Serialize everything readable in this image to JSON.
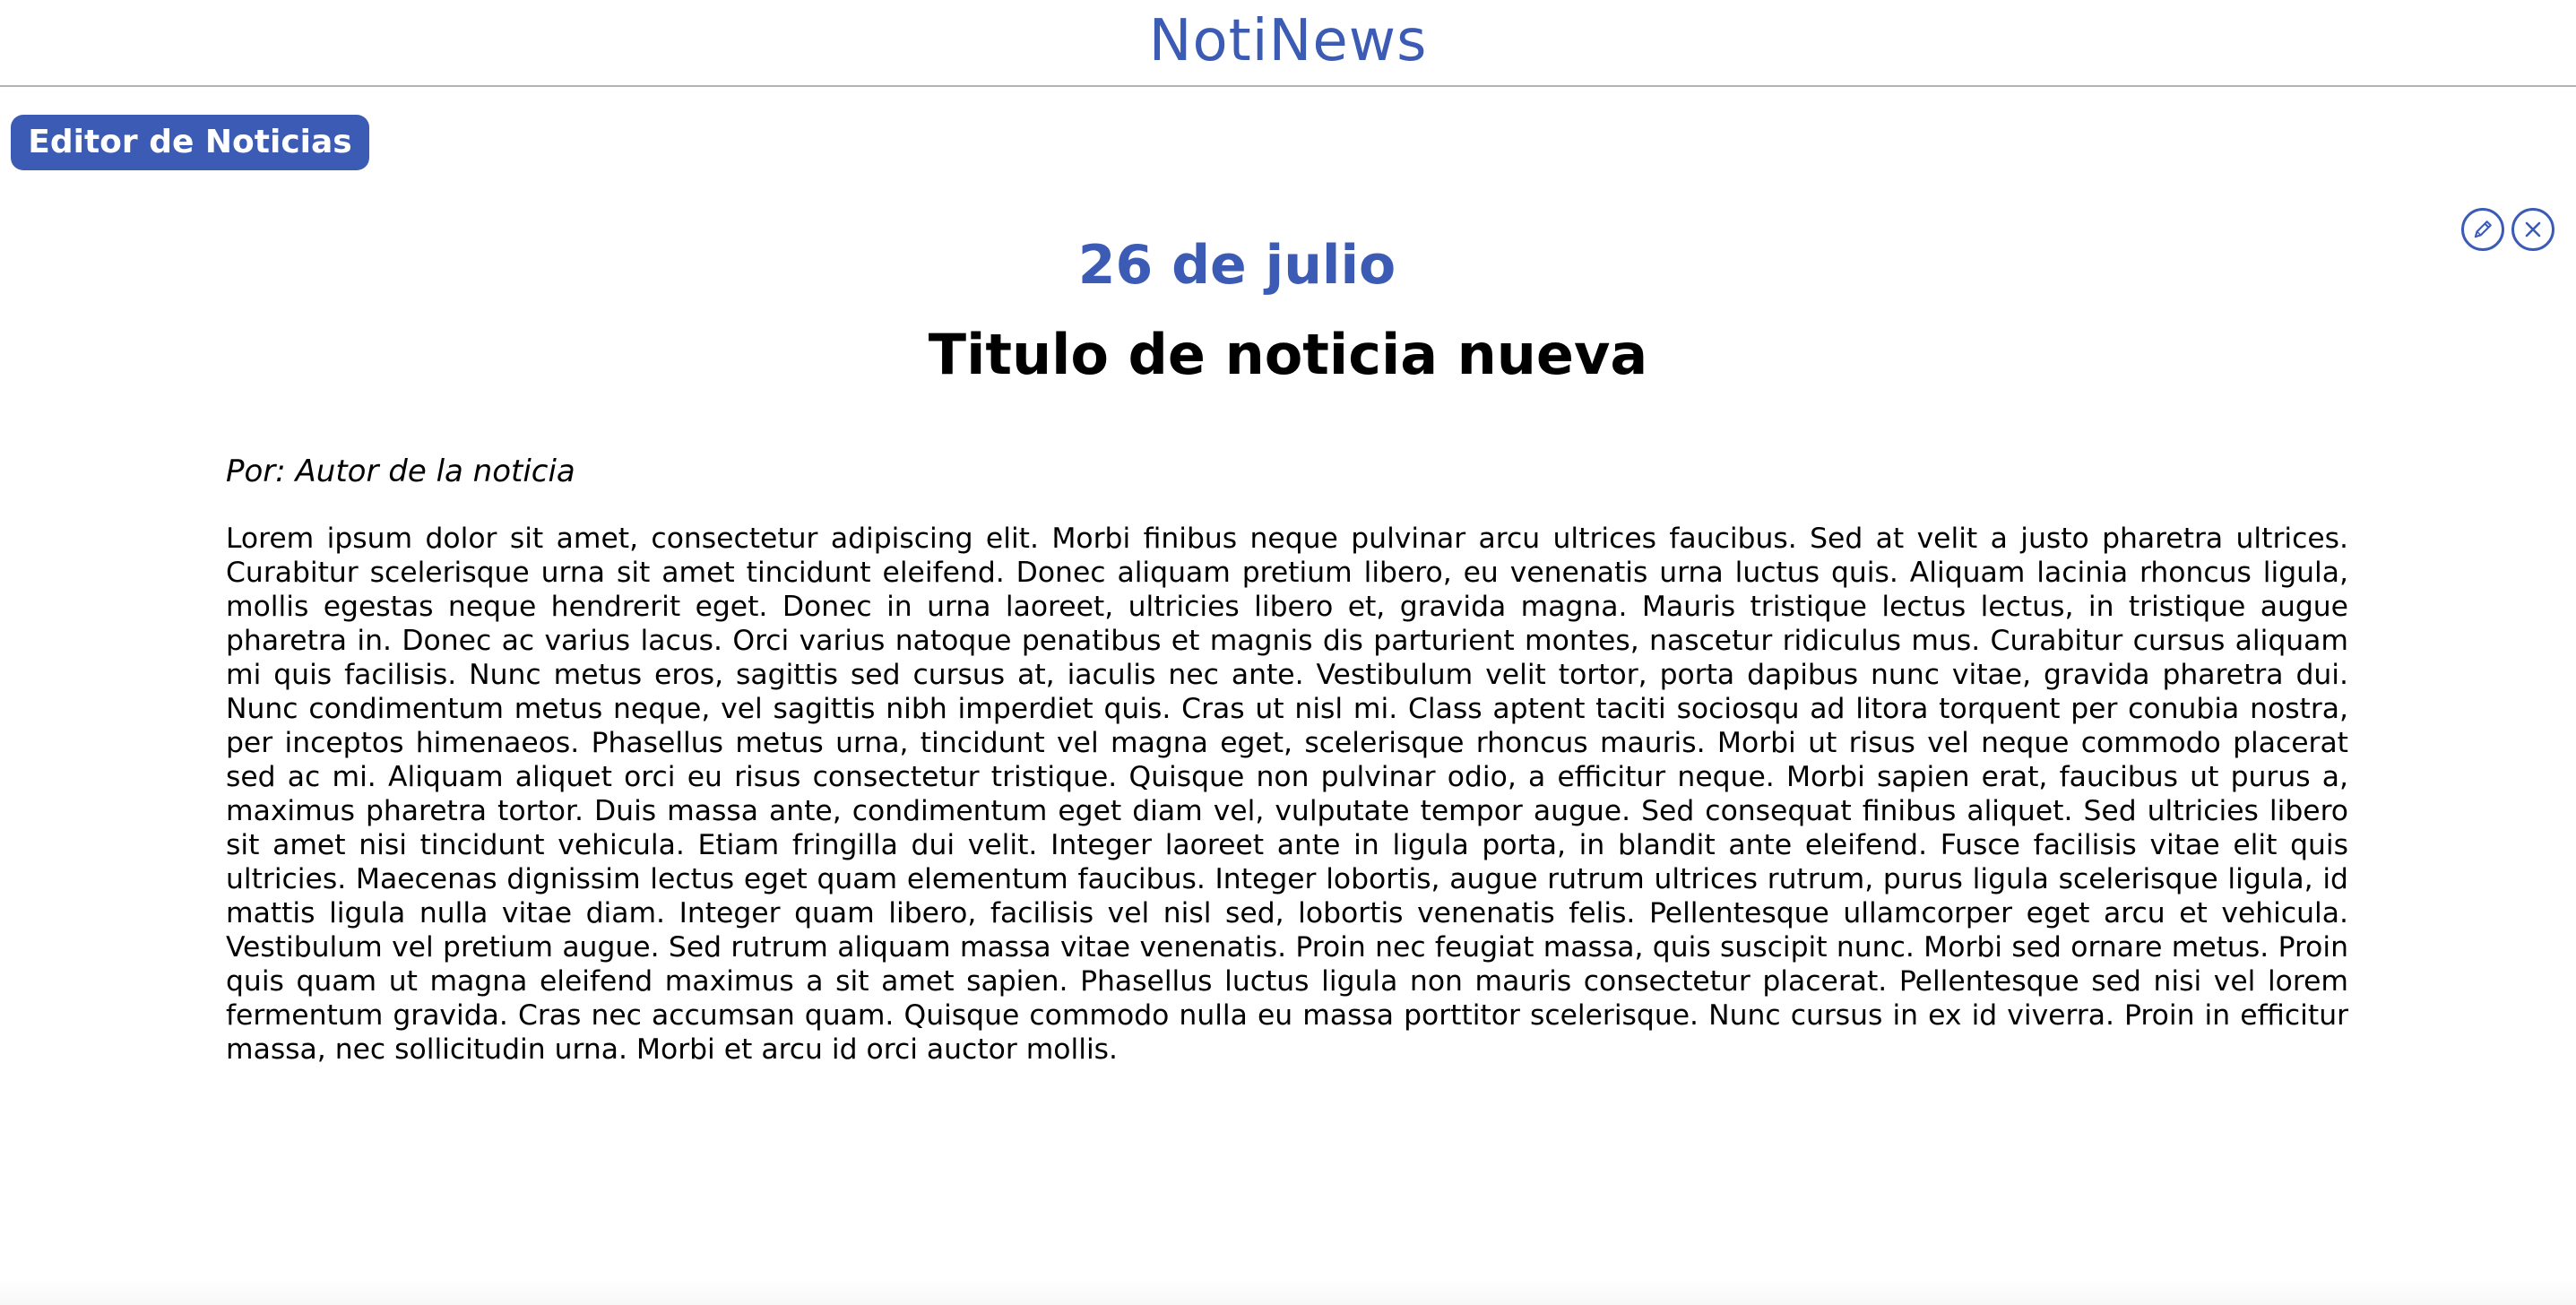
{
  "header": {
    "brand": "NotiNews"
  },
  "toolbar": {
    "editor_label": "Editor de Noticias"
  },
  "article": {
    "date": "26 de julio",
    "title": "Titulo de noticia nueva",
    "author": "Por: Autor de la noticia",
    "body": "Lorem ipsum dolor sit amet, consectetur adipiscing elit. Morbi finibus neque pulvinar arcu ultrices faucibus. Sed at velit a justo pharetra ultrices. Curabitur scelerisque urna sit amet tincidunt eleifend. Donec aliquam pretium libero, eu venenatis urna luctus quis. Aliquam lacinia rhoncus ligula, mollis egestas neque hendrerit eget. Donec in urna laoreet, ultricies libero et, gravida magna. Mauris tristique lectus lectus, in tristique augue pharetra in. Donec ac varius lacus. Orci varius natoque penatibus et magnis dis parturient montes, nascetur ridiculus mus. Curabitur cursus aliquam mi quis facilisis. Nunc metus eros, sagittis sed cursus at, iaculis nec ante. Vestibulum velit tortor, porta dapibus nunc vitae, gravida pharetra dui. Nunc condimentum metus neque, vel sagittis nibh imperdiet quis. Cras ut nisl mi. Class aptent taciti sociosqu ad litora torquent per conubia nostra, per inceptos himenaeos. Phasellus metus urna, tincidunt vel magna eget, scelerisque rhoncus mauris. Morbi ut risus vel neque commodo placerat sed ac mi. Aliquam aliquet orci eu risus consectetur tristique. Quisque non pulvinar odio, a efficitur neque. Morbi sapien erat, faucibus ut purus a, maximus pharetra tortor. Duis massa ante, condimentum eget diam vel, vulputate tempor augue. Sed consequat finibus aliquet. Sed ultricies libero sit amet nisi tincidunt vehicula. Etiam fringilla dui velit. Integer laoreet ante in ligula porta, in blandit ante eleifend. Fusce facilisis vitae elit quis ultricies. Maecenas dignissim lectus eget quam elementum faucibus. Integer lobortis, augue rutrum ultrices rutrum, purus ligula scelerisque ligula, id mattis ligula nulla vitae diam. Integer quam libero, facilisis vel nisl sed, lobortis venenatis felis. Pellentesque ullamcorper eget arcu et vehicula. Vestibulum vel pretium augue. Sed rutrum aliquam massa vitae venenatis. Proin nec feugiat massa, quis suscipit nunc. Morbi sed ornare metus. Proin quis quam ut magna eleifend maximus a sit amet sapien. Phasellus luctus ligula non mauris consectetur placerat. Pellentesque sed nisi vel lorem fermentum gravida. Cras nec accumsan quam. Quisque commodo nulla eu massa porttitor scelerisque. Nunc cursus in ex id viverra. Proin in efficitur massa, nec sollicitudin urna. Morbi et arcu id orci auctor mollis."
  },
  "icons": {
    "edit": "pencil-icon",
    "close": "close-icon"
  },
  "colors": {
    "accent": "#3b5bb5",
    "text": "#000000",
    "divider": "#b4b4b4"
  }
}
